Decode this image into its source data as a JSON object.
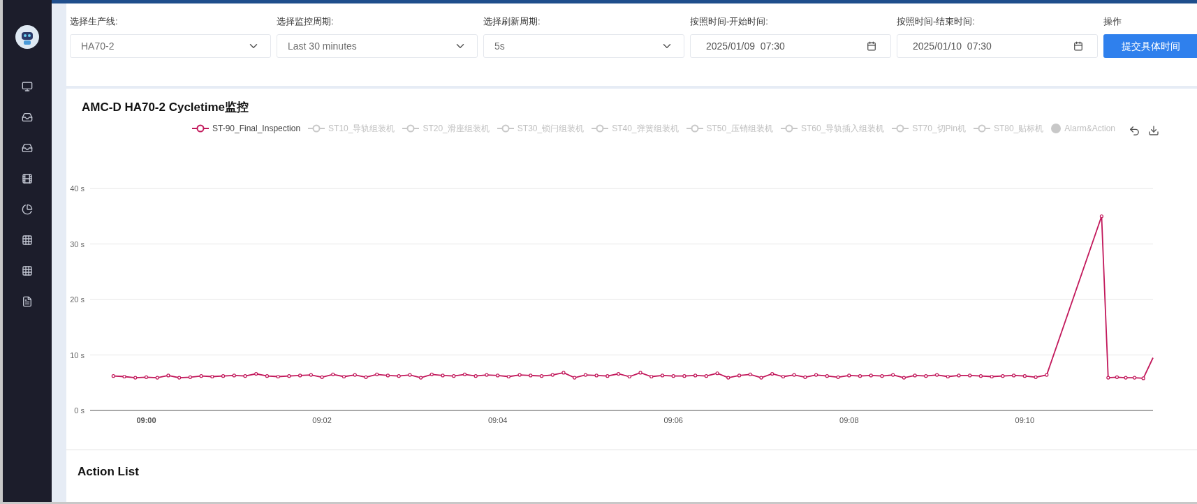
{
  "filters": [
    {
      "label": "选择生产线:",
      "kind": "select",
      "value": "HA70-2"
    },
    {
      "label": "选择监控周期:",
      "kind": "select",
      "value": "Last 30 minutes"
    },
    {
      "label": "选择刷新周期:",
      "kind": "select",
      "value": "5s"
    },
    {
      "label": "按照时间-开始时间:",
      "kind": "date",
      "value": "2025/01/09  07:30"
    },
    {
      "label": "按照时间-结束时间:",
      "kind": "date",
      "value": "2025/01/10  07:30"
    },
    {
      "label": "操作",
      "kind": "button",
      "value": "提交具体时间"
    }
  ],
  "chart": {
    "title": "AMC-D HA70-2 Cycletime监控",
    "legend": [
      {
        "label": "ST-90_Final_Inspection",
        "selected": true,
        "kind": "line"
      },
      {
        "label": "ST10_导轨组装机",
        "selected": false,
        "kind": "line"
      },
      {
        "label": "ST20_滑座组装机",
        "selected": false,
        "kind": "line"
      },
      {
        "label": "ST30_锁闩组装机",
        "selected": false,
        "kind": "line"
      },
      {
        "label": "ST40_弹簧组装机",
        "selected": false,
        "kind": "line"
      },
      {
        "label": "ST50_压销组装机",
        "selected": false,
        "kind": "line"
      },
      {
        "label": "ST60_导轨插入组装机",
        "selected": false,
        "kind": "line"
      },
      {
        "label": "ST70_切Pin机",
        "selected": false,
        "kind": "line"
      },
      {
        "label": "ST80_贴标机",
        "selected": false,
        "kind": "line"
      },
      {
        "label": "Alarm&Action",
        "selected": false,
        "kind": "dot"
      }
    ],
    "chart_data": {
      "type": "line",
      "grid": true,
      "xlim": [
        539.36,
        551.46
      ],
      "ylim": [
        0,
        40
      ],
      "xticks": [
        {
          "value": 540,
          "label": "09:00"
        },
        {
          "value": 542,
          "label": "09:02"
        },
        {
          "value": 544,
          "label": "09:04"
        },
        {
          "value": 546,
          "label": "09:06"
        },
        {
          "value": 548,
          "label": "09:08"
        },
        {
          "value": 550,
          "label": "09:10"
        }
      ],
      "yticks": [
        {
          "value": 0,
          "label": "0 s"
        },
        {
          "value": 10,
          "label": "10 s"
        },
        {
          "value": 20,
          "label": "20 s"
        },
        {
          "value": 30,
          "label": "30 s"
        },
        {
          "value": 40,
          "label": "40 s"
        }
      ],
      "x": [
        539.625,
        539.75,
        539.875,
        540,
        540.125,
        540.25,
        540.375,
        540.5,
        540.625,
        540.75,
        540.875,
        541,
        541.125,
        541.25,
        541.375,
        541.5,
        541.625,
        541.75,
        541.875,
        542,
        542.125,
        542.25,
        542.375,
        542.5,
        542.625,
        542.75,
        542.875,
        543,
        543.125,
        543.25,
        543.375,
        543.5,
        543.625,
        543.75,
        543.875,
        544,
        544.125,
        544.25,
        544.375,
        544.5,
        544.625,
        544.75,
        544.875,
        545,
        545.125,
        545.25,
        545.375,
        545.5,
        545.625,
        545.75,
        545.875,
        546,
        546.125,
        546.25,
        546.375,
        546.5,
        546.625,
        546.75,
        546.875,
        547,
        547.125,
        547.25,
        547.375,
        547.5,
        547.625,
        547.75,
        547.875,
        548,
        548.125,
        548.25,
        548.375,
        548.5,
        548.625,
        548.75,
        548.875,
        549,
        549.125,
        549.25,
        549.375,
        549.5,
        549.625,
        549.75,
        549.875,
        550,
        550.125,
        550.25,
        550.875,
        550.95,
        551.05,
        551.15,
        551.25,
        551.35,
        551.46
      ],
      "series": [
        {
          "marker": "circle",
          "color": "#c2185b",
          "values": [
            6.2,
            6.1,
            5.9,
            6.0,
            5.9,
            6.3,
            5.9,
            6.0,
            6.2,
            6.1,
            6.2,
            6.3,
            6.2,
            6.6,
            6.2,
            6.1,
            6.2,
            6.3,
            6.4,
            6.0,
            6.5,
            6.1,
            6.4,
            6.0,
            6.5,
            6.3,
            6.2,
            6.4,
            5.9,
            6.5,
            6.3,
            6.2,
            6.5,
            6.2,
            6.4,
            6.3,
            6.1,
            6.4,
            6.3,
            6.2,
            6.4,
            6.8,
            5.9,
            6.4,
            6.3,
            6.2,
            6.6,
            6.1,
            6.8,
            6.1,
            6.3,
            6.2,
            6.2,
            6.3,
            6.2,
            6.7,
            5.9,
            6.3,
            6.5,
            5.9,
            6.6,
            6.1,
            6.4,
            6.0,
            6.4,
            6.2,
            6.0,
            6.3,
            6.2,
            6.3,
            6.2,
            6.4,
            5.9,
            6.3,
            6.2,
            6.4,
            6.1,
            6.3,
            6.3,
            6.2,
            6.1,
            6.2,
            6.3,
            6.2,
            6.0,
            6.4,
            35,
            5.9,
            6.0,
            5.9,
            5.9,
            5.8,
            9.5
          ]
        }
      ]
    }
  },
  "action_list": {
    "title": "Action List"
  }
}
